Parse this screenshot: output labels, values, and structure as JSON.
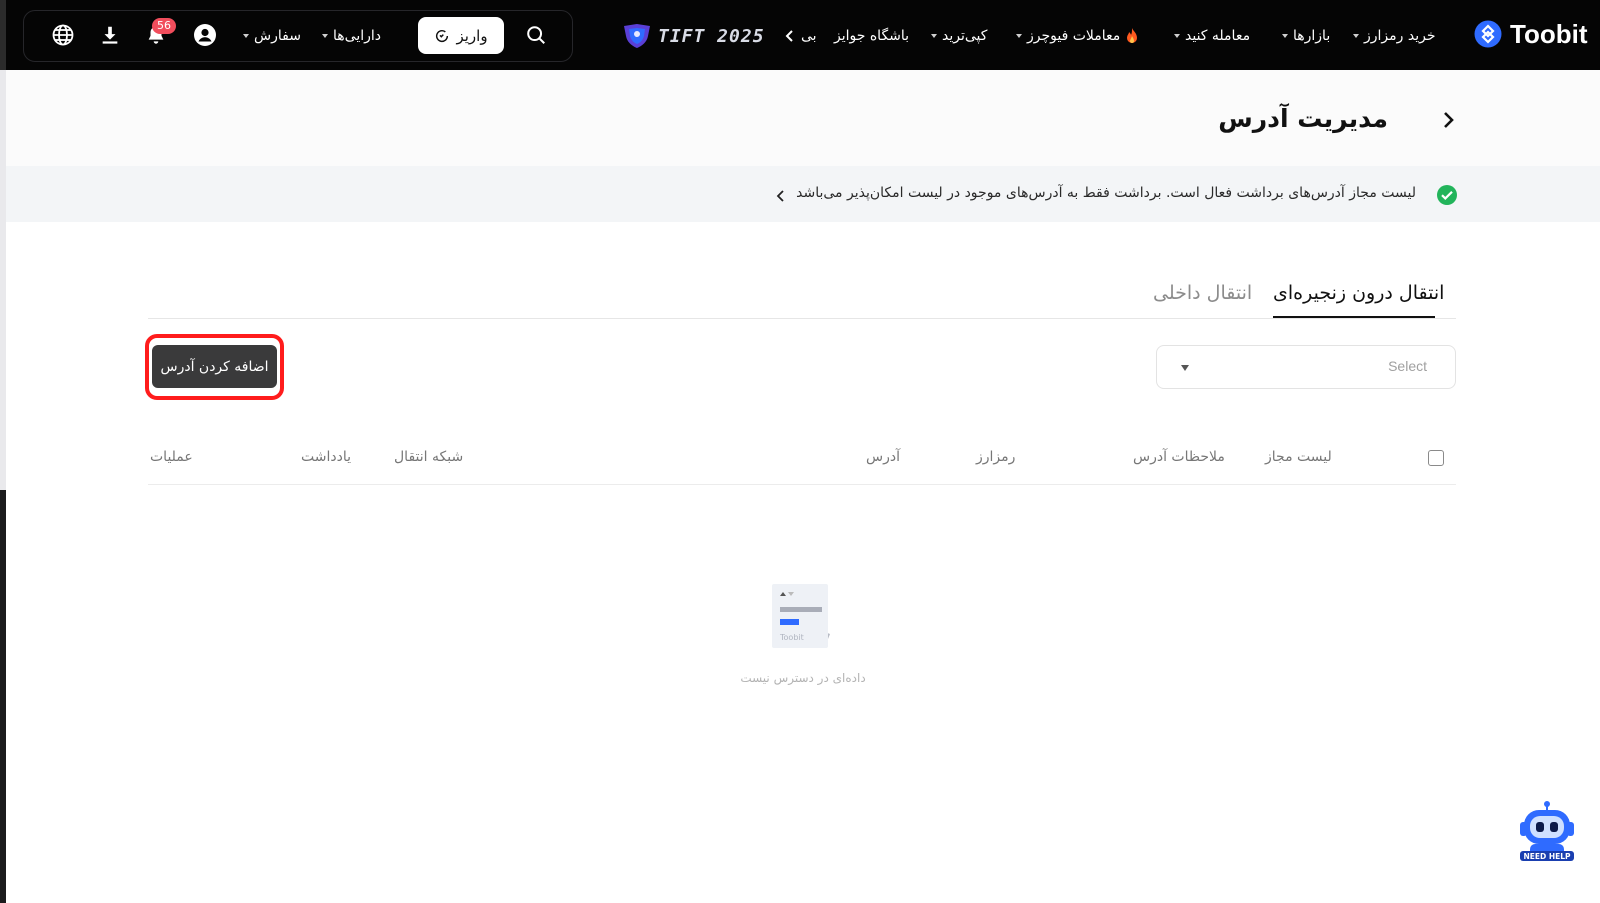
{
  "nav": {
    "brand": "Toobit",
    "links": {
      "buy_crypto": "خرید رمزارز",
      "markets": "بازارها",
      "trade": "معامله کنید",
      "futures": "معاملات فیوچرز",
      "copy_trade": "کپی‌ترید",
      "rewards": "باشگاه جوایز",
      "more": "بی"
    },
    "event": "TIFT 2025",
    "deposit": "واریز",
    "assets": "دارایی‌ها",
    "orders": "سفارش",
    "notification_count": "56"
  },
  "header": {
    "title": "مدیریت آدرس"
  },
  "notice": {
    "text": "لیست مجاز آدرس‌های برداشت فعال است. برداشت فقط به آدرس‌های موجود در لیست امکان‌پذیر می‌باشد"
  },
  "tabs": [
    {
      "label": "انتقال درون زنجیره‌ای",
      "active": true
    },
    {
      "label": "انتقال داخلی",
      "active": false
    }
  ],
  "toolbar": {
    "add_address": "اضافه کردن آدرس",
    "select_placeholder": "Select"
  },
  "table": {
    "columns": {
      "whitelist": "لیست مجاز",
      "remarks": "ملاحظات آدرس",
      "crypto": "رمزارز",
      "address": "آدرس",
      "network": "شبکه انتقال",
      "note": "یادداشت",
      "actions": "عملیات"
    },
    "empty_text": "داده‌ای در دسترس نیست",
    "empty_logo_text": "Toobit"
  },
  "help": {
    "label": "NEED HELP"
  },
  "colors": {
    "accent_blue": "#2f6bff",
    "highlight_red": "#ff1c1c",
    "success_green": "#22b45b",
    "badge_red": "#f14d5c"
  }
}
